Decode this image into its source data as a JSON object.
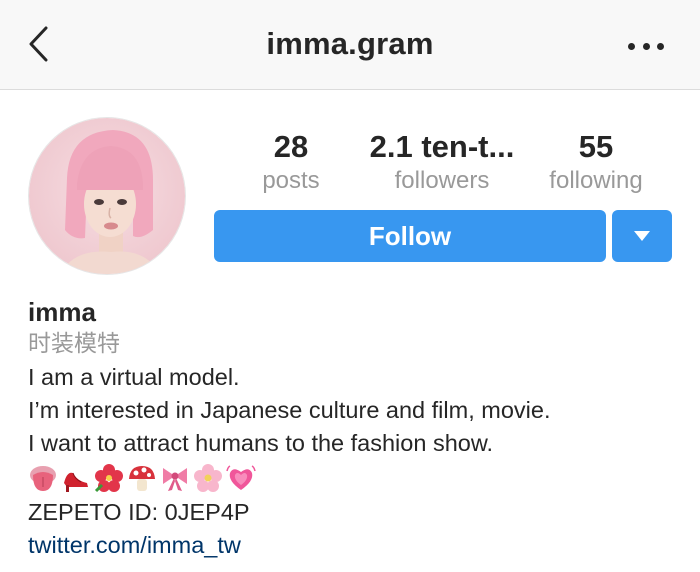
{
  "header": {
    "title": "imma.gram"
  },
  "stats": {
    "posts": {
      "value": "28",
      "label": "posts"
    },
    "followers": {
      "value": "2.1 ten-t...",
      "label": "followers"
    },
    "following": {
      "value": "55",
      "label": "following"
    }
  },
  "actions": {
    "follow_label": "Follow"
  },
  "profile": {
    "name": "imma",
    "category": "时装模特",
    "bio_lines": [
      "I am a virtual model.",
      "I’m interested in Japanese culture and film, movie.",
      "I want to attract humans to the fashion show."
    ],
    "emojis": [
      "tongue-icon",
      "high-heel-icon",
      "hibiscus-icon",
      "mushroom-icon",
      "ribbon-icon",
      "cherry-blossom-icon",
      "growing-heart-icon"
    ],
    "zepeto": "ZEPETO ID: 0JEP4P",
    "link": "twitter.com/imma_tw"
  },
  "colors": {
    "accent": "#3897f0",
    "link": "#003569",
    "muted": "#999999",
    "text": "#262626"
  }
}
